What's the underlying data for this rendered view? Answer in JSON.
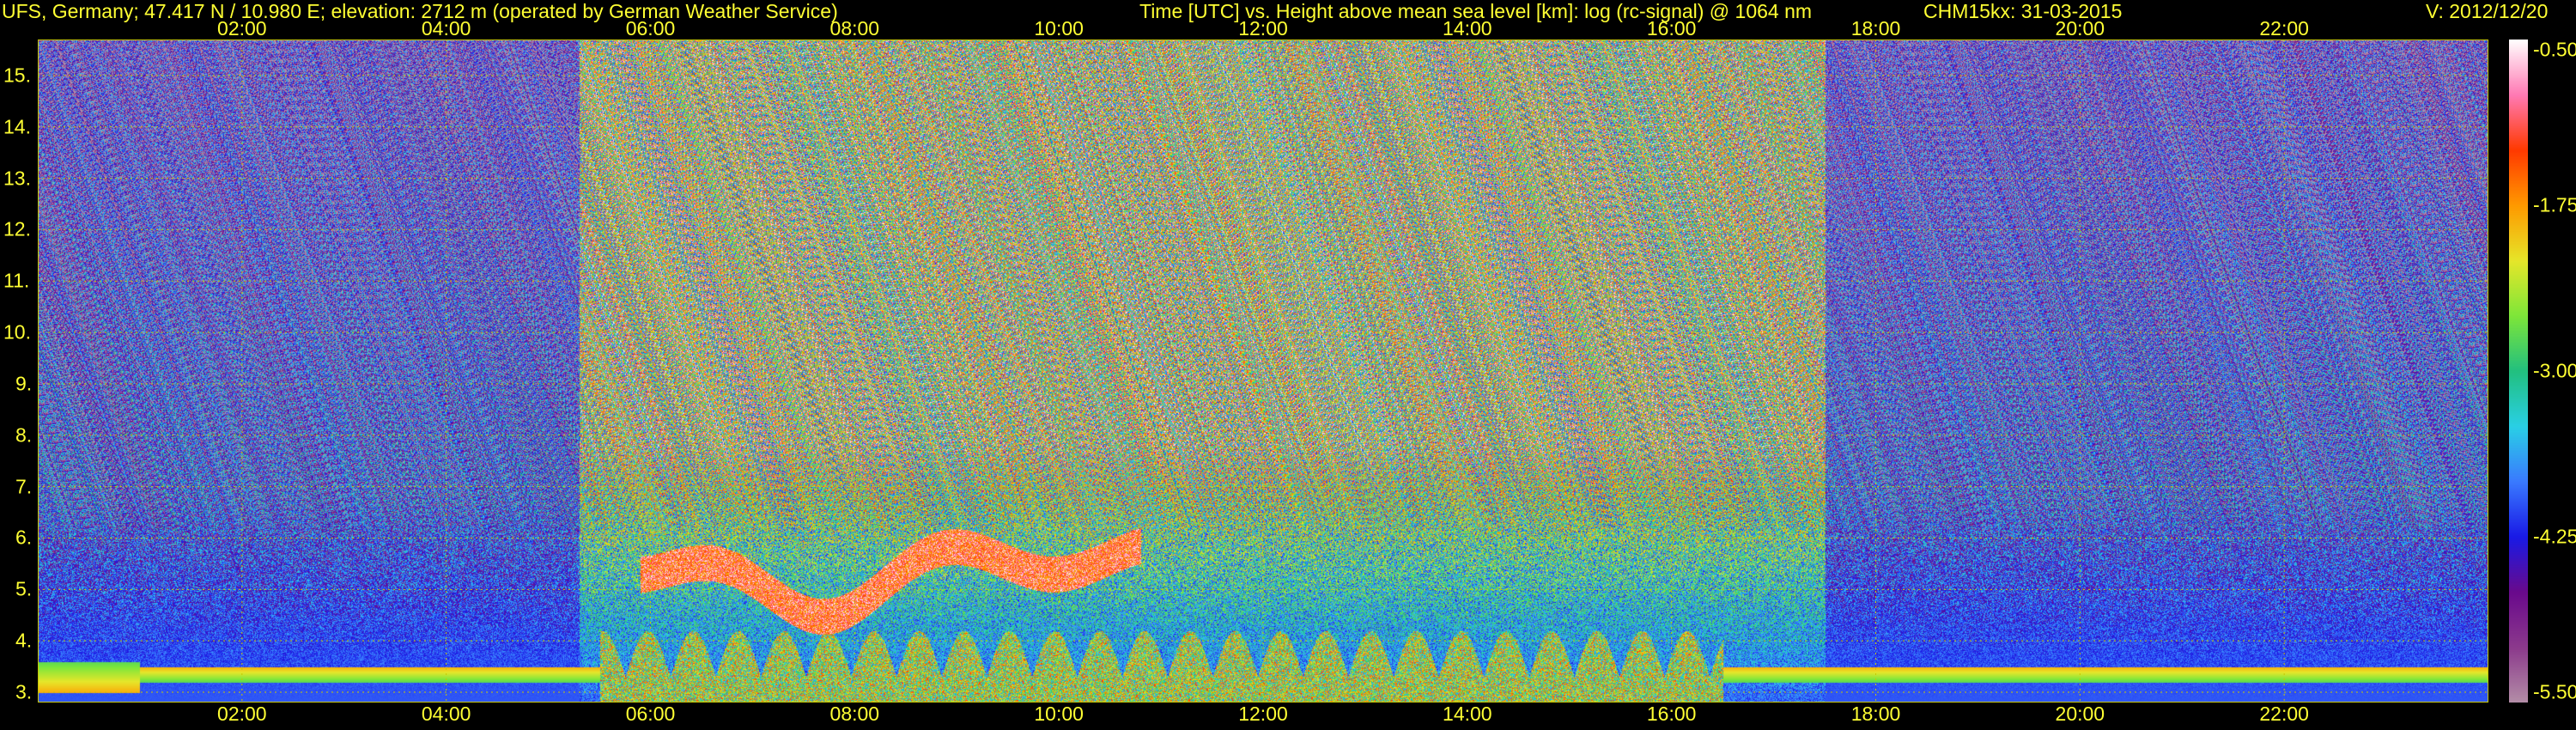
{
  "header": {
    "station": "UFS, Germany; 47.417 N / 10.980 E; elevation: 2712 m  (operated by German Weather Service)",
    "description": "Time [UTC] vs. Height above mean sea level [km]: log (rc-signal) @ 1064 nm",
    "instrument": "CHM15kx: 31-03-2015",
    "version": "V: 2012/12/20"
  },
  "chart_data": {
    "type": "heatmap",
    "xlabel": "Time [UTC]",
    "ylabel": "Height above mean sea level [km]",
    "x_ticks": [
      "02:00",
      "04:00",
      "06:00",
      "08:00",
      "10:00",
      "12:00",
      "14:00",
      "16:00",
      "18:00",
      "20:00",
      "22:00"
    ],
    "x_tick_hours": [
      2,
      4,
      6,
      8,
      10,
      12,
      14,
      16,
      18,
      20,
      22
    ],
    "xlim_hours": [
      0,
      24
    ],
    "y_ticks": [
      "3.",
      "4.",
      "5.",
      "6.",
      "7.",
      "8.",
      "9.",
      "10.",
      "11.",
      "12.",
      "13.",
      "14.",
      "15."
    ],
    "y_tick_values": [
      3,
      4,
      5,
      6,
      7,
      8,
      9,
      10,
      11,
      12,
      13,
      14,
      15
    ],
    "ylim_km": [
      2.8,
      15.7
    ],
    "colorbar": {
      "label": "log (rc-signal)",
      "ticks": [
        "-0.50",
        "-1.75",
        "-3.00",
        "-4.25",
        "-5.50"
      ],
      "tick_values": [
        -0.5,
        -1.75,
        -3.0,
        -4.25,
        -5.5
      ],
      "range": [
        -5.5,
        -0.5
      ],
      "colors": [
        "#b48fa8",
        "#8c3a8c",
        "#6a0a8c",
        "#1a1ae6",
        "#3a7aff",
        "#2ad0e6",
        "#22c080",
        "#7ee63a",
        "#e6e62a",
        "#ff9a00",
        "#ff3a00",
        "#ff7ab4",
        "#ffffff"
      ]
    },
    "features": [
      {
        "name": "cloud layer",
        "time_range_hours": [
          5.9,
          10.8
        ],
        "height_km_range": [
          4.7,
          6.5
        ]
      },
      {
        "name": "boundary layer",
        "time_range_hours": [
          5.5,
          16.5
        ],
        "height_km_range": [
          2.9,
          4.3
        ]
      },
      {
        "name": "residual layer",
        "time_range_hours": [
          1.0,
          23.9
        ],
        "height_km_range": [
          3.2,
          3.5
        ]
      }
    ],
    "grid": true
  }
}
